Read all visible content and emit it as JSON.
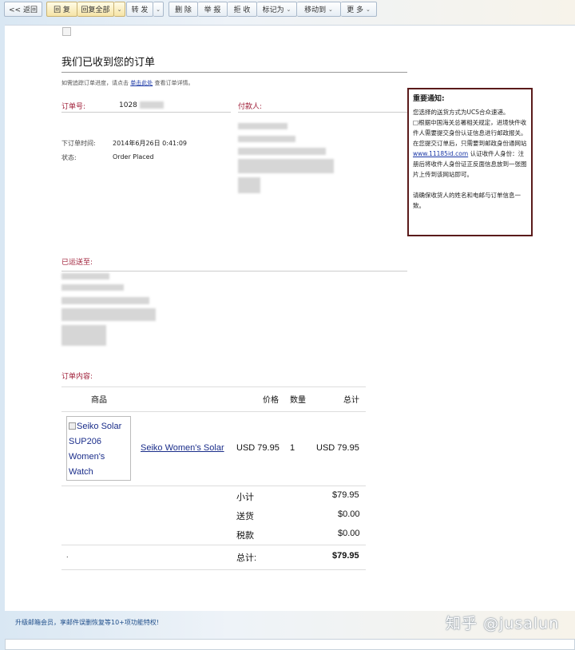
{
  "toolbar": {
    "back": "<< 返回",
    "reply": "回 复",
    "reply_all": "回复全部",
    "forward": "转 发",
    "delete": "删 除",
    "report": "举 报",
    "reject": "拒 收",
    "mark_as": "标记为",
    "move_to": "移动到",
    "more": "更 多"
  },
  "email": {
    "title": "我们已收到您的订单",
    "track_prefix": "如需追踪订单进度，请点击",
    "track_link": "单击此处",
    "track_suffix": "查看订单详情。",
    "order_no_label": "订单号:",
    "order_no_value": "1028",
    "payer_label": "付款人:",
    "order_time_label": "下订单时间:",
    "order_time_value": "2014年6月26日 0:41:09",
    "status_label": "状态:",
    "status_value": "Order Placed",
    "shipped_to_label": "已运送至:",
    "contents_label": "订单内容:"
  },
  "notice": {
    "title": "重要通知:",
    "p1_a": "您选择的送货方式为UCS合众速递。",
    "p1_b": "□根据中国海关总署相关规定，进境快件收件人需要提交身份认证信息进行邮政报关。在您提交订单后，只需要到邮政身份通网站",
    "link": "www.11185id.com",
    "p1_c": "认证收件人身份：注册后将收件人身份证正反面信息放到一张图片上传到该网站即可。",
    "p2": "请确保收货人的姓名和电邮与订单信息一致。"
  },
  "table": {
    "headers": {
      "product": "商品",
      "price": "价格",
      "qty": "数量",
      "total": "总计"
    },
    "item": {
      "img_alt": "Seiko Solar SUP206 Women's Watch",
      "name": "Seiko Women's Solar",
      "price": "USD 79.95",
      "qty": "1",
      "total": "USD 79.95"
    },
    "subtotal_label": "小计",
    "subtotal_value": "$79.95",
    "shipping_label": "送货",
    "shipping_value": "$0.00",
    "tax_label": "税款",
    "tax_value": "$0.00",
    "dot": ".",
    "grand_label": "总计:",
    "grand_value": "$79.95"
  },
  "promo": "升级邮箱会员，享邮件误删恢复等10+项功能特权!",
  "watermark": "知乎 @jusalun"
}
